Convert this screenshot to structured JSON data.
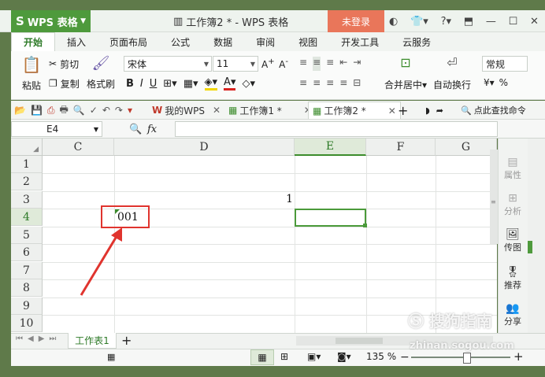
{
  "app": {
    "name": "WPS 表格",
    "window_title": "工作簿2 * - WPS 表格",
    "login": "未登录"
  },
  "ribbon_tabs": [
    "开始",
    "插入",
    "页面布局",
    "公式",
    "数据",
    "审阅",
    "视图",
    "开发工具",
    "云服务"
  ],
  "ribbon": {
    "paste": "粘贴",
    "cut": "剪切",
    "copy": "复制",
    "format_painter": "格式刷",
    "font": "宋体",
    "font_size": "11",
    "merge": "合并居中",
    "wrap": "自动换行",
    "number_format": "常规",
    "percent": "%"
  },
  "quick": {
    "my_wps": "我的WPS",
    "doc1": "工作簿1 *",
    "doc2": "工作簿2 *",
    "search": "点此查找命令"
  },
  "formula_bar": {
    "name_box": "E4",
    "fx": "fx"
  },
  "columns": [
    {
      "label": "C",
      "selected": false
    },
    {
      "label": "D",
      "selected": false
    },
    {
      "label": "E",
      "selected": true
    },
    {
      "label": "F",
      "selected": false
    },
    {
      "label": "G",
      "selected": false
    }
  ],
  "rows": [
    "1",
    "2",
    "3",
    "4",
    "5",
    "6",
    "7",
    "8",
    "9",
    "10"
  ],
  "cells": {
    "D3": "1",
    "C4": "001"
  },
  "right_panel": [
    "属性",
    "分析",
    "传图",
    "推荐",
    "分享"
  ],
  "sheet_tab": "工作表1",
  "status": {
    "zoom": "135 %"
  },
  "watermark": {
    "text": "搜狗指南",
    "url": "zhinan.sogou.com"
  },
  "colors": {
    "accent": "#4e9a3c",
    "login": "#e9765a",
    "highlight": "#e0342e"
  }
}
